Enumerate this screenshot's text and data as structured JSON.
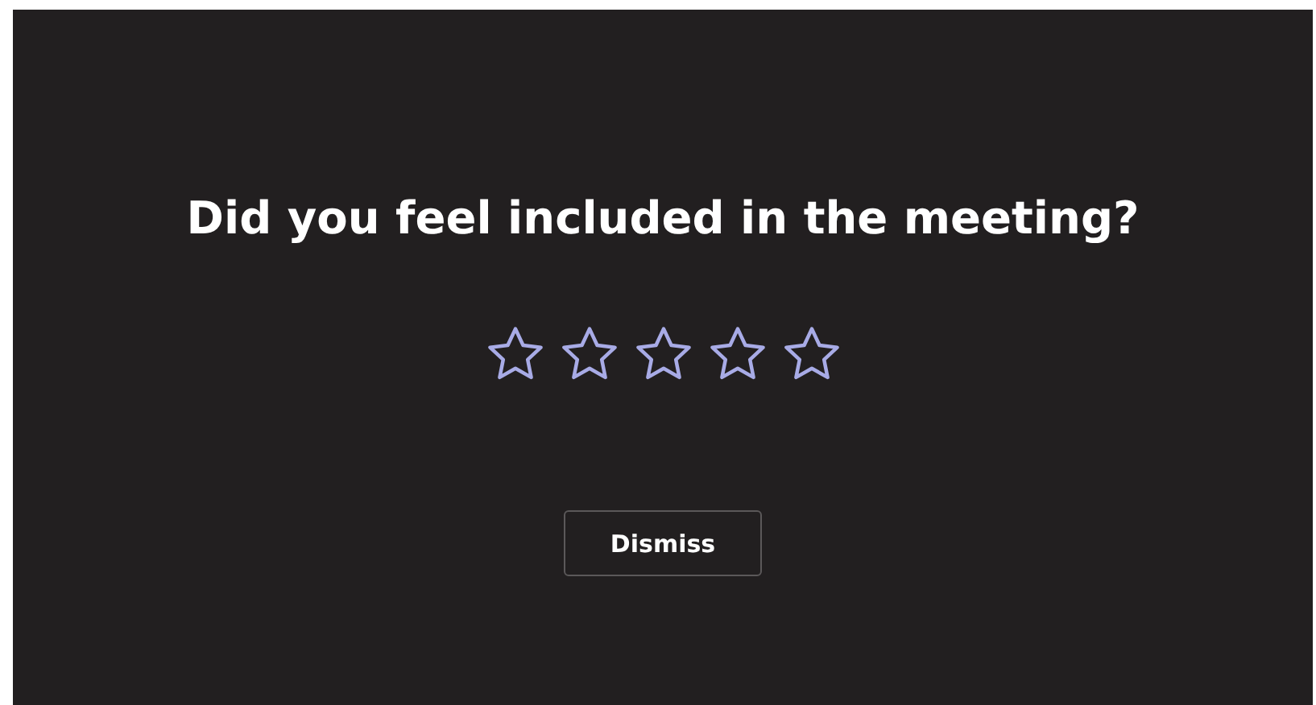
{
  "prompt": {
    "question": "Did you feel included in the meeting?",
    "rating": {
      "stars": 0
    },
    "buttons": [
      {
        "label": "Dismiss"
      }
    ]
  }
}
